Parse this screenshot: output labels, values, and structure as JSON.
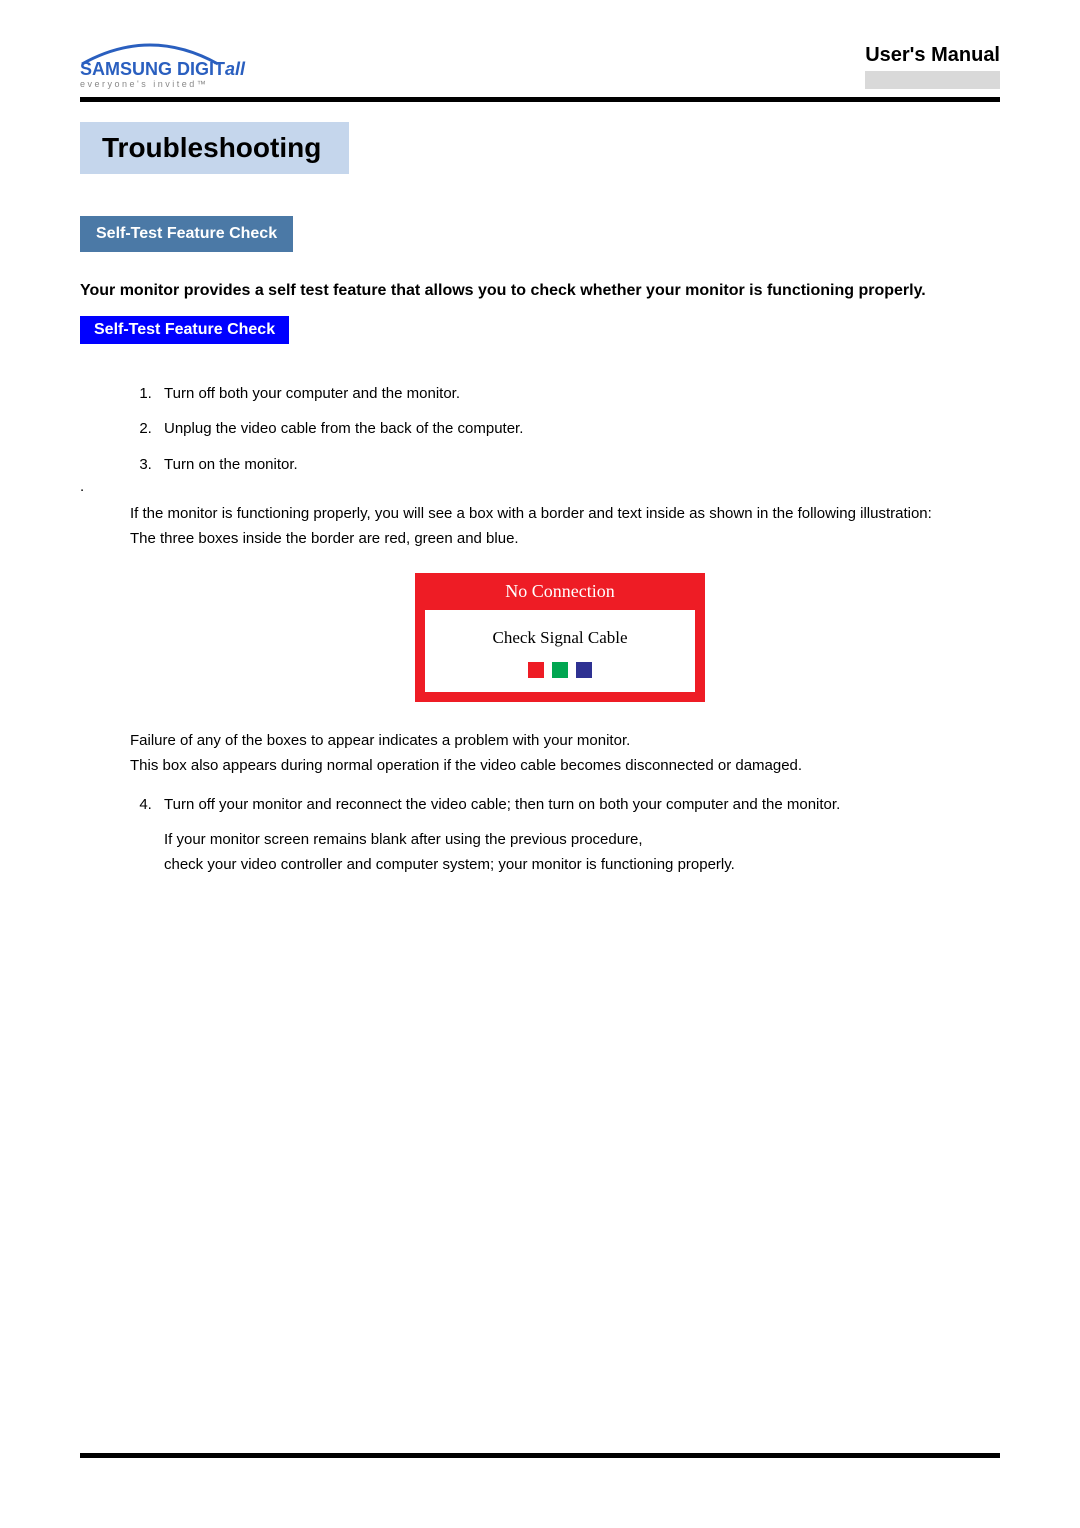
{
  "header": {
    "logo_brand": "SAMSUNG",
    "logo_sub": "DIGIT",
    "logo_ital": "all",
    "logo_tagline": "everyone's invited™",
    "manual_title": "User's Manual"
  },
  "title": "Troubleshooting",
  "section_badge": "Self-Test Feature Check",
  "intro": "Your monitor provides a self test feature that allows you to check whether your monitor is functioning properly.",
  "sub_badge": "Self-Test Feature Check",
  "steps": {
    "s1": "Turn off both your computer and the monitor.",
    "s2": "Unplug the video cable from the back of the computer.",
    "s3": "Turn on the monitor."
  },
  "dot": ".",
  "after3_line1": "If the monitor is functioning properly, you will see a box with a border and  text inside as shown in the following illustration:",
  "after3_line2": "The three boxes inside the border are red, green and blue.",
  "illustration": {
    "top": "No Connection",
    "inner": "Check Signal Cable"
  },
  "post_illus_1": "Failure of any of the boxes to appear indicates a problem with your monitor.",
  "post_illus_2": "This box also appears during normal operation if the video cable becomes disconnected or damaged.",
  "step4": "Turn off your monitor and reconnect the video cable; then turn on both your computer and the monitor.",
  "step4_after_1": "If your monitor screen remains blank after using the previous procedure,",
  "step4_after_2": "check your video controller and computer system; your monitor is functioning properly."
}
